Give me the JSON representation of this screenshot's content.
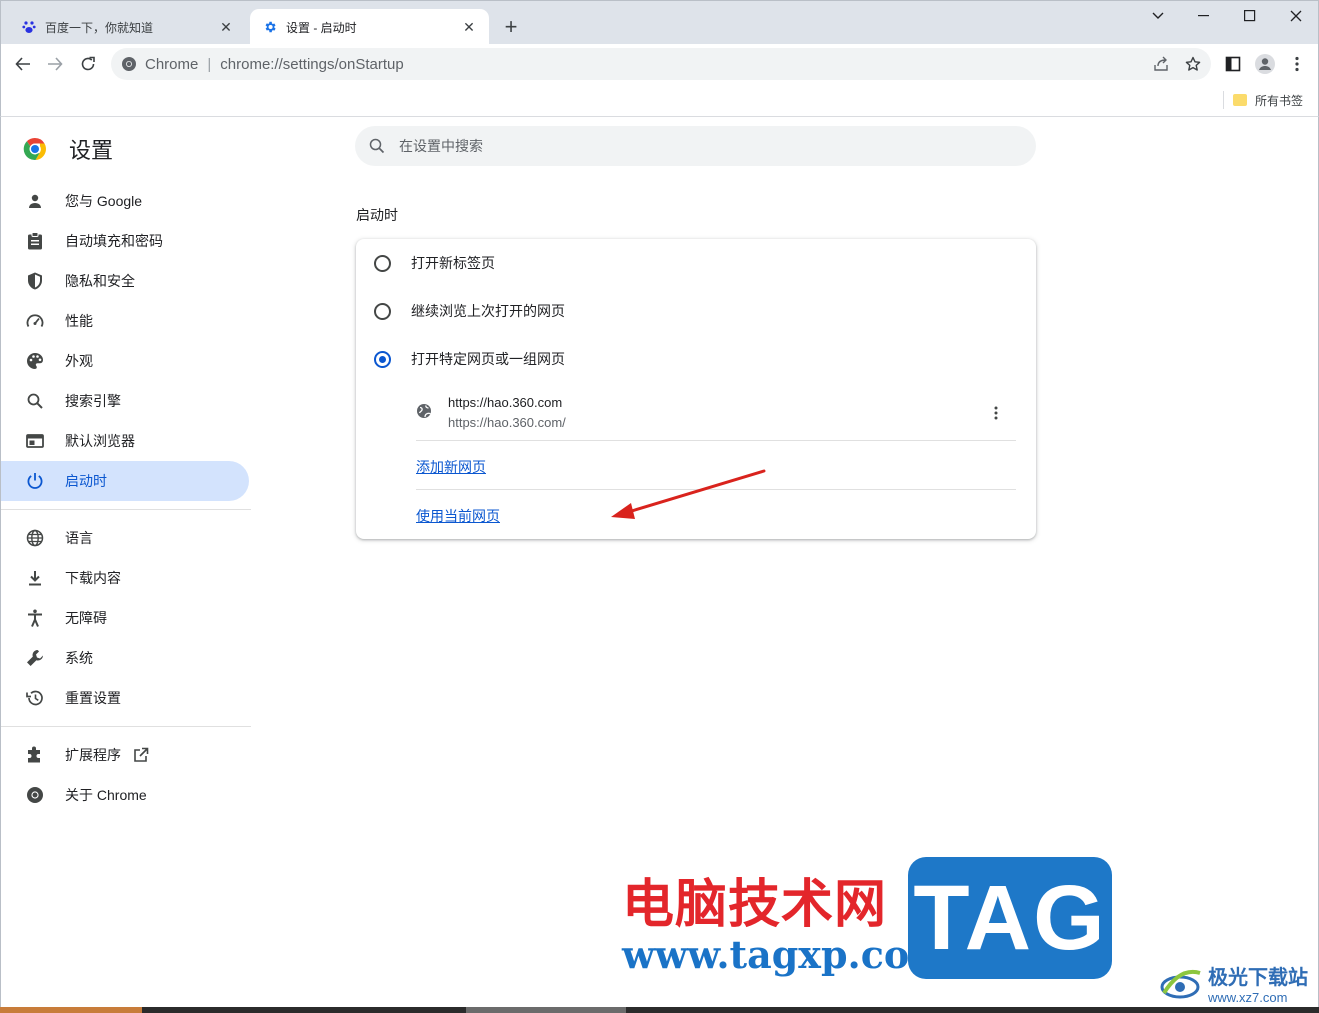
{
  "tabs": [
    {
      "title": "百度一下，你就知道",
      "icon": "baidu-paw-icon"
    },
    {
      "title": "设置 - 启动时",
      "icon": "gear-icon",
      "active": true
    }
  ],
  "toolbar": {
    "site_label": "Chrome",
    "separator": "|",
    "url": "chrome://settings/onStartup"
  },
  "bookmarks": {
    "all_label": "所有书签"
  },
  "settings": {
    "title": "设置",
    "search_placeholder": "在设置中搜索"
  },
  "nav": {
    "group1": [
      {
        "label": "您与 Google",
        "icon": "person-icon"
      },
      {
        "label": "自动填充和密码",
        "icon": "clipboard-icon"
      },
      {
        "label": "隐私和安全",
        "icon": "shield-icon"
      },
      {
        "label": "性能",
        "icon": "speedometer-icon"
      },
      {
        "label": "外观",
        "icon": "palette-icon"
      },
      {
        "label": "搜索引擎",
        "icon": "search-icon"
      },
      {
        "label": "默认浏览器",
        "icon": "browser-window-icon"
      },
      {
        "label": "启动时",
        "icon": "power-icon",
        "active": true
      }
    ],
    "group2": [
      {
        "label": "语言",
        "icon": "globe-icon"
      },
      {
        "label": "下载内容",
        "icon": "download-icon"
      },
      {
        "label": "无障碍",
        "icon": "accessibility-icon"
      },
      {
        "label": "系统",
        "icon": "wrench-icon"
      },
      {
        "label": "重置设置",
        "icon": "history-icon"
      }
    ],
    "group3": [
      {
        "label": "扩展程序",
        "icon": "puzzle-icon"
      },
      {
        "label": "关于 Chrome",
        "icon": "chrome-logo-icon"
      }
    ]
  },
  "startup": {
    "section_title": "启动时",
    "options": [
      {
        "label": "打开新标签页",
        "checked": false
      },
      {
        "label": "继续浏览上次打开的网页",
        "checked": false
      },
      {
        "label": "打开特定网页或一组网页",
        "checked": true
      }
    ],
    "site": {
      "name": "https://hao.360.com",
      "url": "https://hao.360.com/"
    },
    "add_page_link": "添加新网页",
    "use_current_link": "使用当前网页"
  },
  "watermark": {
    "cn_text": "电脑技术网",
    "url_text": "www.tagxp.com",
    "tag_text": "TAG",
    "jg_text": "极光下载站",
    "jg_url": "www.xz7.com"
  },
  "colors": {
    "accent": "#0b57d0",
    "nav_active_bg": "#d3e3fd",
    "arrow": "#d9231d"
  }
}
